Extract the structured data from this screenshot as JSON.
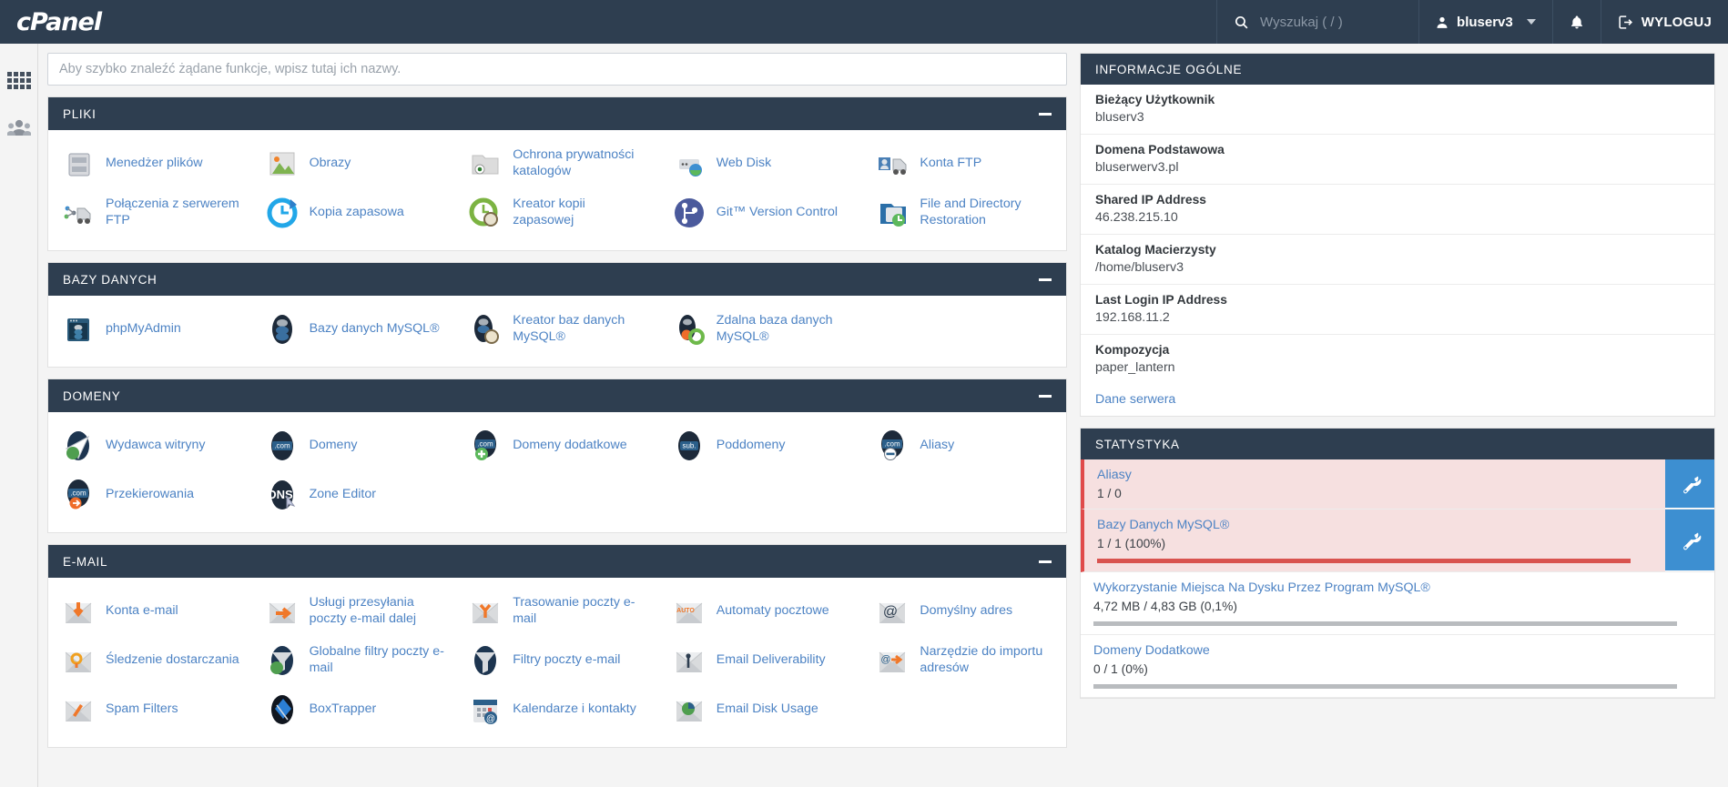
{
  "topbar": {
    "brand": "cPanel",
    "search_placeholder": "Wyszukaj ( / )",
    "search_icon": "search-icon",
    "user": "bluserv3",
    "user_icon": "user-icon",
    "notifications_icon": "bell-icon",
    "logout_label": "WYLOGUJ",
    "logout_icon": "logout-icon"
  },
  "rail": {
    "items": [
      {
        "icon": "apps-grid-icon",
        "name": "apps"
      },
      {
        "icon": "users-icon",
        "name": "users"
      }
    ]
  },
  "search": {
    "placeholder": "Aby szybko znaleźć żądane funkcje, wpisz tutaj ich nazwy.",
    "value": ""
  },
  "sections": [
    {
      "title": "PLIKI",
      "collapse_icon": "minus-icon",
      "items": [
        {
          "label": "Menedżer plików",
          "icon": "file-manager-icon"
        },
        {
          "label": "Obrazy",
          "icon": "images-icon"
        },
        {
          "label": "Ochrona prywatności katalogów",
          "icon": "directory-privacy-icon"
        },
        {
          "label": "Web Disk",
          "icon": "web-disk-icon"
        },
        {
          "label": "Konta FTP",
          "icon": "ftp-accounts-icon"
        },
        {
          "label": "Połączenia z serwerem FTP",
          "icon": "ftp-connections-icon"
        },
        {
          "label": "Kopia zapasowa",
          "icon": "backup-icon"
        },
        {
          "label": "Kreator kopii zapasowej",
          "icon": "backup-wizard-icon"
        },
        {
          "label": "Git™ Version Control",
          "icon": "git-icon"
        },
        {
          "label": "File and Directory Restoration",
          "icon": "file-restore-icon"
        }
      ]
    },
    {
      "title": "BAZY DANYCH",
      "collapse_icon": "minus-icon",
      "items": [
        {
          "label": "phpMyAdmin",
          "icon": "phpmyadmin-icon"
        },
        {
          "label": "Bazy danych MySQL®",
          "icon": "mysql-databases-icon"
        },
        {
          "label": "Kreator baz danych MySQL®",
          "icon": "mysql-wizard-icon"
        },
        {
          "label": "Zdalna baza danych MySQL®",
          "icon": "remote-mysql-icon"
        }
      ]
    },
    {
      "title": "DOMENY",
      "collapse_icon": "minus-icon",
      "items": [
        {
          "label": "Wydawca witryny",
          "icon": "site-publisher-icon"
        },
        {
          "label": "Domeny",
          "icon": "domains-icon"
        },
        {
          "label": "Domeny dodatkowe",
          "icon": "addon-domains-icon"
        },
        {
          "label": "Poddomeny",
          "icon": "subdomains-icon"
        },
        {
          "label": "Aliasy",
          "icon": "aliases-icon"
        },
        {
          "label": "Przekierowania",
          "icon": "redirects-icon"
        },
        {
          "label": "Zone Editor",
          "icon": "dns-zone-editor-icon"
        }
      ]
    },
    {
      "title": "E-MAIL",
      "collapse_icon": "minus-icon",
      "items": [
        {
          "label": "Konta e-mail",
          "icon": "email-accounts-icon"
        },
        {
          "label": "Usługi przesyłania poczty e-mail dalej",
          "icon": "forwarders-icon"
        },
        {
          "label": "Trasowanie poczty e-mail",
          "icon": "email-routing-icon"
        },
        {
          "label": "Automaty pocztowe",
          "icon": "autoresponders-icon"
        },
        {
          "label": "Domyślny adres",
          "icon": "default-address-icon"
        },
        {
          "label": "Śledzenie dostarczania",
          "icon": "track-delivery-icon"
        },
        {
          "label": "Globalne filtry poczty e-mail",
          "icon": "global-filters-icon"
        },
        {
          "label": "Filtry poczty e-mail",
          "icon": "email-filters-icon"
        },
        {
          "label": "Email Deliverability",
          "icon": "email-deliverability-icon"
        },
        {
          "label": "Narzędzie do importu adresów",
          "icon": "address-importer-icon"
        },
        {
          "label": "Spam Filters",
          "icon": "spam-filters-icon"
        },
        {
          "label": "BoxTrapper",
          "icon": "boxtrapper-icon"
        },
        {
          "label": "Kalendarze i kontakty",
          "icon": "calendars-contacts-icon"
        },
        {
          "label": "Email Disk Usage",
          "icon": "email-disk-usage-icon"
        }
      ]
    }
  ],
  "general_info": {
    "title": "INFORMACJE OGÓLNE",
    "items": [
      {
        "label": "Bieżący Użytkownik",
        "value": "bluserv3"
      },
      {
        "label": "Domena Podstawowa",
        "value": "bluserwerv3.pl"
      },
      {
        "label": "Shared IP Address",
        "value": "46.238.215.10"
      },
      {
        "label": "Katalog Macierzysty",
        "value": "/home/bluserv3"
      },
      {
        "label": "Last Login IP Address",
        "value": "192.168.11.2"
      },
      {
        "label": "Kompozycja",
        "value": "paper_lantern"
      }
    ],
    "link": "Dane serwera"
  },
  "statistics": {
    "title": "STATYSTYKA",
    "action_icon": "wrench-icon",
    "items": [
      {
        "name": "Aliasy",
        "value": "1 / 0",
        "warn": true,
        "bar": false,
        "percent": 0,
        "has_action": true
      },
      {
        "name": "Bazy Danych MySQL®",
        "value": "1 / 1  (100%)",
        "warn": true,
        "bar": true,
        "bar_color": "#d9534f",
        "percent": 100,
        "has_action": true
      },
      {
        "name": "Wykorzystanie Miejsca Na Dysku Przez Program MySQL®",
        "value": "4,72 MB / 4,83 GB  (0,1%)",
        "warn": false,
        "bar": true,
        "bar_color": "#b9bcbf",
        "percent": 0.1,
        "has_action": false
      },
      {
        "name": "Domeny Dodatkowe",
        "value": "0 / 1  (0%)",
        "warn": false,
        "bar": true,
        "bar_color": "#b9bcbf",
        "percent": 0,
        "has_action": false
      }
    ]
  },
  "colors": {
    "header_bg": "#2e3e50",
    "link": "#4d83c4",
    "accent_blue": "#3d8fd1",
    "warn_bg": "#f6e0e0",
    "warn_border": "#e04b4b",
    "page_bg": "#f4f4f4"
  }
}
